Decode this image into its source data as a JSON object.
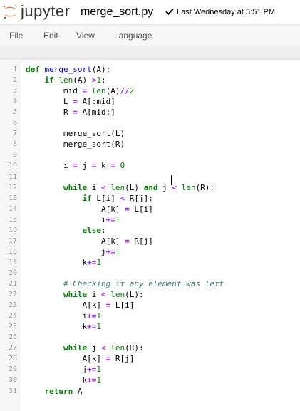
{
  "header": {
    "brand": "jupyter",
    "filename": "merge_sort.py",
    "last_saved": "Last Wednesday at 5:51 PM",
    "logo_icon": "jupyter-logo-icon",
    "saved_icon": "checkmark-icon"
  },
  "menu": [
    "File",
    "Edit",
    "View",
    "Language"
  ],
  "colors": {
    "keyword": "#008000",
    "function_name": "#0000ff",
    "operator": "#aa22ff",
    "number": "#008800",
    "comment": "#408080",
    "logo_orange": "#f37726",
    "line_number": "#999999"
  },
  "code_lines": [
    "def merge_sort(A):",
    "    if len(A) >1:",
    "        mid = len(A)//2",
    "        L = A[:mid]",
    "        R = A[mid:]",
    "",
    "        merge_sort(L)",
    "        merge_sort(R)",
    "",
    "        i = j = k = 0",
    "",
    "        while i < len(L) and j < len(R):",
    "            if L[i] < R[j]:",
    "                A[k] = L[i]",
    "                i+=1",
    "            else:",
    "                A[k] = R[j]",
    "                j+=1",
    "            k+=1",
    "",
    "        # Checking if any element was left",
    "        while i < len(L):",
    "            A[k] = L[i]",
    "            i+=1",
    "            k+=1",
    "",
    "        while j < len(R):",
    "            A[k] = R[j]",
    "            j+=1",
    "            k+=1",
    "    return A"
  ]
}
